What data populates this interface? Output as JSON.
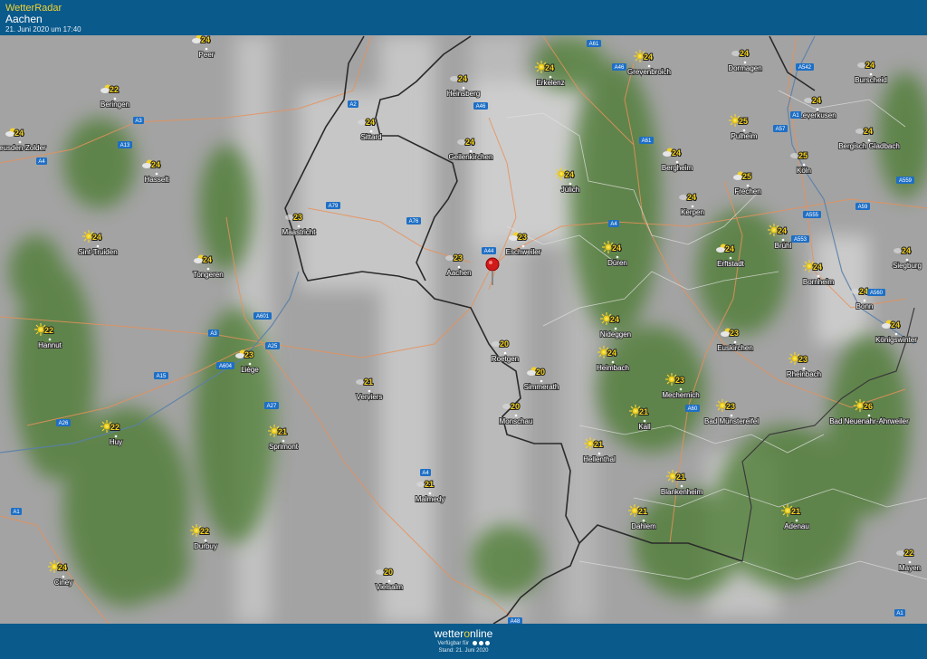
{
  "header": {
    "app_title": "WetterRadar",
    "location": "Aachen",
    "timestamp": "21. Juni 2020 um 17:40"
  },
  "footer": {
    "brand_before": "wetter",
    "brand_o": "o",
    "brand_after": "nline",
    "availability": "Verfügbar für",
    "stand": "Stand: 21. Juni 2020"
  },
  "map": {
    "marker": "Aachen",
    "cities": [
      {
        "name": "Peer",
        "temp": "24",
        "icon": "cloud-sun-icon"
      },
      {
        "name": "Beringen",
        "temp": "22",
        "icon": "cloud-sun-icon"
      },
      {
        "name": "Heusden-Zolder",
        "temp": "24",
        "icon": "cloud-sun-icon"
      },
      {
        "name": "Hasselt",
        "temp": "24",
        "icon": "cloud-sun-icon"
      },
      {
        "name": "Sint-Truiden",
        "temp": "24",
        "icon": "sun-icon"
      },
      {
        "name": "Tongeren",
        "temp": "24",
        "icon": "cloud-sun-icon"
      },
      {
        "name": "Hannut",
        "temp": "22",
        "icon": "sun-icon"
      },
      {
        "name": "Liège",
        "temp": "23",
        "icon": "cloud-sun-icon"
      },
      {
        "name": "Huy",
        "temp": "22",
        "icon": "sun-icon"
      },
      {
        "name": "Ciney",
        "temp": "24",
        "icon": "sun-icon"
      },
      {
        "name": "Durbuy",
        "temp": "22",
        "icon": "sun-icon"
      },
      {
        "name": "Verviers",
        "temp": "21",
        "icon": "cloud-icon"
      },
      {
        "name": "Sprimont",
        "temp": "21",
        "icon": "sun-icon"
      },
      {
        "name": "Malmedy",
        "temp": "21",
        "icon": "cloud-icon"
      },
      {
        "name": "Vielsalm",
        "temp": "20",
        "icon": "cloud-icon"
      },
      {
        "name": "Maastricht",
        "temp": "23",
        "icon": "cloud-icon"
      },
      {
        "name": "Sittard",
        "temp": "24",
        "icon": "cloud-icon"
      },
      {
        "name": "Heinsberg",
        "temp": "24",
        "icon": "cloud-icon"
      },
      {
        "name": "Geilenkirchen",
        "temp": "24",
        "icon": "cloud-icon"
      },
      {
        "name": "Aachen",
        "temp": "23",
        "icon": "cloud-icon"
      },
      {
        "name": "Eschweiler",
        "temp": "23",
        "icon": "cloud-sun-icon"
      },
      {
        "name": "Roetgen",
        "temp": "20",
        "icon": "cloud-icon"
      },
      {
        "name": "Simmerath",
        "temp": "20",
        "icon": "cloud-sun-icon"
      },
      {
        "name": "Monschau",
        "temp": "20",
        "icon": "cloud-icon"
      },
      {
        "name": "Erkelenz",
        "temp": "24",
        "icon": "sun-icon"
      },
      {
        "name": "Jülich",
        "temp": "24",
        "icon": "sun-icon"
      },
      {
        "name": "Düren",
        "temp": "24",
        "icon": "sun-icon"
      },
      {
        "name": "Nideggen",
        "temp": "24",
        "icon": "sun-icon"
      },
      {
        "name": "Heimbach",
        "temp": "24",
        "icon": "sun-icon"
      },
      {
        "name": "Hellenthal",
        "temp": "21",
        "icon": "sun-icon"
      },
      {
        "name": "Kall",
        "temp": "21",
        "icon": "sun-icon"
      },
      {
        "name": "Mechernich",
        "temp": "23",
        "icon": "sun-icon"
      },
      {
        "name": "Blankenheim",
        "temp": "21",
        "icon": "sun-icon"
      },
      {
        "name": "Dahlem",
        "temp": "21",
        "icon": "sun-icon"
      },
      {
        "name": "Grevenbroich",
        "temp": "24",
        "icon": "sun-icon"
      },
      {
        "name": "Bergheim",
        "temp": "24",
        "icon": "cloud-sun-icon"
      },
      {
        "name": "Kerpen",
        "temp": "24",
        "icon": "cloud-icon"
      },
      {
        "name": "Erftstadt",
        "temp": "24",
        "icon": "cloud-sun-icon"
      },
      {
        "name": "Euskirchen",
        "temp": "23",
        "icon": "cloud-sun-icon"
      },
      {
        "name": "Bad Münstereifel",
        "temp": "23",
        "icon": "sun-icon"
      },
      {
        "name": "Rheinbach",
        "temp": "23",
        "icon": "sun-icon"
      },
      {
        "name": "Dormagen",
        "temp": "24",
        "icon": "cloud-icon"
      },
      {
        "name": "Pulheim",
        "temp": "25",
        "icon": "sun-icon"
      },
      {
        "name": "Frechen",
        "temp": "25",
        "icon": "cloud-sun-icon"
      },
      {
        "name": "Köln",
        "temp": "25",
        "icon": "cloud-icon"
      },
      {
        "name": "Brühl",
        "temp": "24",
        "icon": "sun-icon"
      },
      {
        "name": "Bornheim",
        "temp": "24",
        "icon": "sun-icon"
      },
      {
        "name": "Leverkusen",
        "temp": "24",
        "icon": "cloud-icon"
      },
      {
        "name": "Burscheid",
        "temp": "24",
        "icon": "cloud-icon"
      },
      {
        "name": "Bergisch Gladbach",
        "temp": "24",
        "icon": "cloud-icon"
      },
      {
        "name": "Siegburg",
        "temp": "24",
        "icon": "cloud-icon"
      },
      {
        "name": "Bonn",
        "temp": "24",
        "icon": "cloud-icon"
      },
      {
        "name": "Königswinter",
        "temp": "24",
        "icon": "cloud-sun-icon"
      },
      {
        "name": "Bad Neuenahr-Ahrweiler",
        "temp": "26",
        "icon": "sun-icon"
      },
      {
        "name": "Adenau",
        "temp": "21",
        "icon": "sun-icon"
      },
      {
        "name": "Mayen",
        "temp": "22",
        "icon": "cloud-icon"
      }
    ],
    "roads": [
      "A61",
      "A46",
      "A542",
      "A1",
      "A2",
      "A3",
      "A13",
      "A57",
      "A61",
      "A4",
      "A559",
      "A555",
      "A553",
      "A59",
      "A560",
      "A79",
      "A76",
      "A44",
      "A46",
      "A601",
      "A25",
      "A604",
      "A15",
      "A26",
      "A27",
      "A4",
      "A1",
      "A60",
      "A48",
      "A1",
      "A3",
      "A4"
    ]
  },
  "colors": {
    "header_bg": "#0a5a8c",
    "accent": "#f2d230"
  }
}
